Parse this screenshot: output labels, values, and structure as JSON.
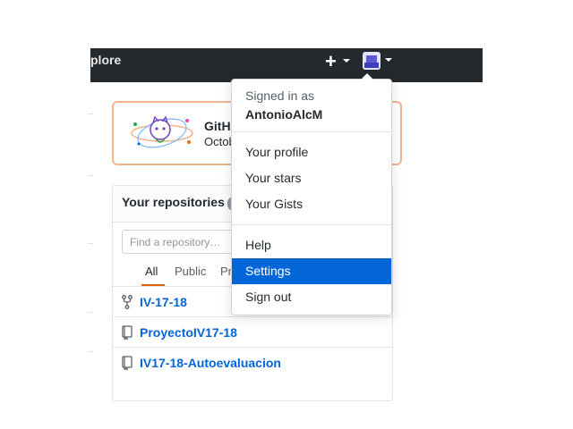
{
  "header": {
    "nav_explore": "plore",
    "new_button_icon": "plus-icon",
    "avatar_icon": "user-avatar"
  },
  "banner": {
    "title": "GitHu",
    "subtitle": "Octob",
    "illustration_icon": "octocat-universe-icon"
  },
  "repositories": {
    "title": "Your repositories",
    "search_placeholder": "Find a repository…",
    "filters": [
      "All",
      "Public",
      "Pr"
    ],
    "active_filter": "All",
    "items": [
      {
        "name": "IV-17-18",
        "icon": "repo-forked-icon"
      },
      {
        "name": "ProyectoIV17-18",
        "icon": "repo-icon"
      },
      {
        "name": "IV17-18-Autoevaluacion",
        "icon": "repo-icon"
      }
    ]
  },
  "user_menu": {
    "signed_in_label": "Signed in as",
    "username": "AntonioAlcM",
    "items": [
      "Your profile",
      "Your stars",
      "Your Gists",
      "Help",
      "Settings",
      "Sign out"
    ],
    "highlighted": "Settings"
  },
  "colors": {
    "header_bg": "#24292e",
    "link": "#0366d6",
    "highlight_bg": "#0366d6",
    "tab_underline": "#e36209"
  }
}
